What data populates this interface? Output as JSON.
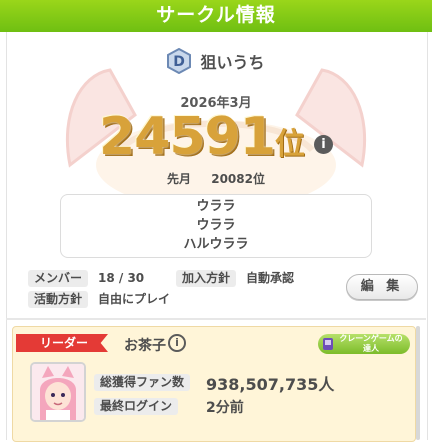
{
  "header": {
    "title": "サークル情報"
  },
  "circle": {
    "name": "狙いうち",
    "badge_letter": "D",
    "month": "2026年3月",
    "rank": "24591",
    "rank_unit": "位",
    "last_month_label": "先月",
    "last_month_rank": "20082位",
    "slogan_lines": [
      "ウララ",
      "ウララ",
      "ハルウララ"
    ]
  },
  "fields": {
    "members_label": "メンバー",
    "members_value": "18 / 30",
    "join_label": "加入方針",
    "join_value": "自動承認",
    "activity_label": "活動方針",
    "activity_value": "自由にプレイ"
  },
  "buttons": {
    "edit_label": "編 集",
    "info_glyph": "i"
  },
  "leader": {
    "tag": "リーダー",
    "name": "お茶子",
    "crane_badge_line1": "クレーンゲームの",
    "crane_badge_line2": "達人",
    "fans_label": "総獲得ファン数",
    "fans_value": "938,507,735人",
    "login_label": "最終ログイン",
    "login_value": "2分前"
  },
  "colors": {
    "header_green": "#7ac915",
    "rank_gold": "#d8a23a",
    "leader_red": "#e43a36",
    "card_bg": "#fff5d8"
  },
  "icons": [
    "d-rank-badge-icon",
    "info-icon",
    "crane-game-icon",
    "trainer-avatar"
  ]
}
